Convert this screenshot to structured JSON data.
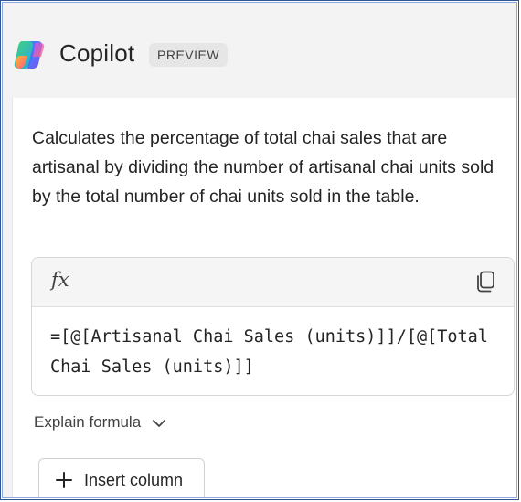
{
  "header": {
    "app_name": "Copilot",
    "badge": "PREVIEW",
    "logo_icon": "copilot-logo"
  },
  "response": {
    "description": "Calculates the percentage of total chai sales that are artisanal by dividing the number of artisanal chai units sold by the total number of chai units sold in the table.",
    "formula_icon": "fx",
    "formula": "=[@[Artisanal Chai Sales (units)]]/[@[Total Chai Sales (units)]]",
    "copy_icon": "copy-icon",
    "explain_label": "Explain formula",
    "insert_label": "Insert column"
  },
  "colors": {
    "frame_border": "#2f5597",
    "header_bg": "#f3f3f3",
    "badge_bg": "#e6e6e6",
    "card_border": "#d6d6d6"
  }
}
